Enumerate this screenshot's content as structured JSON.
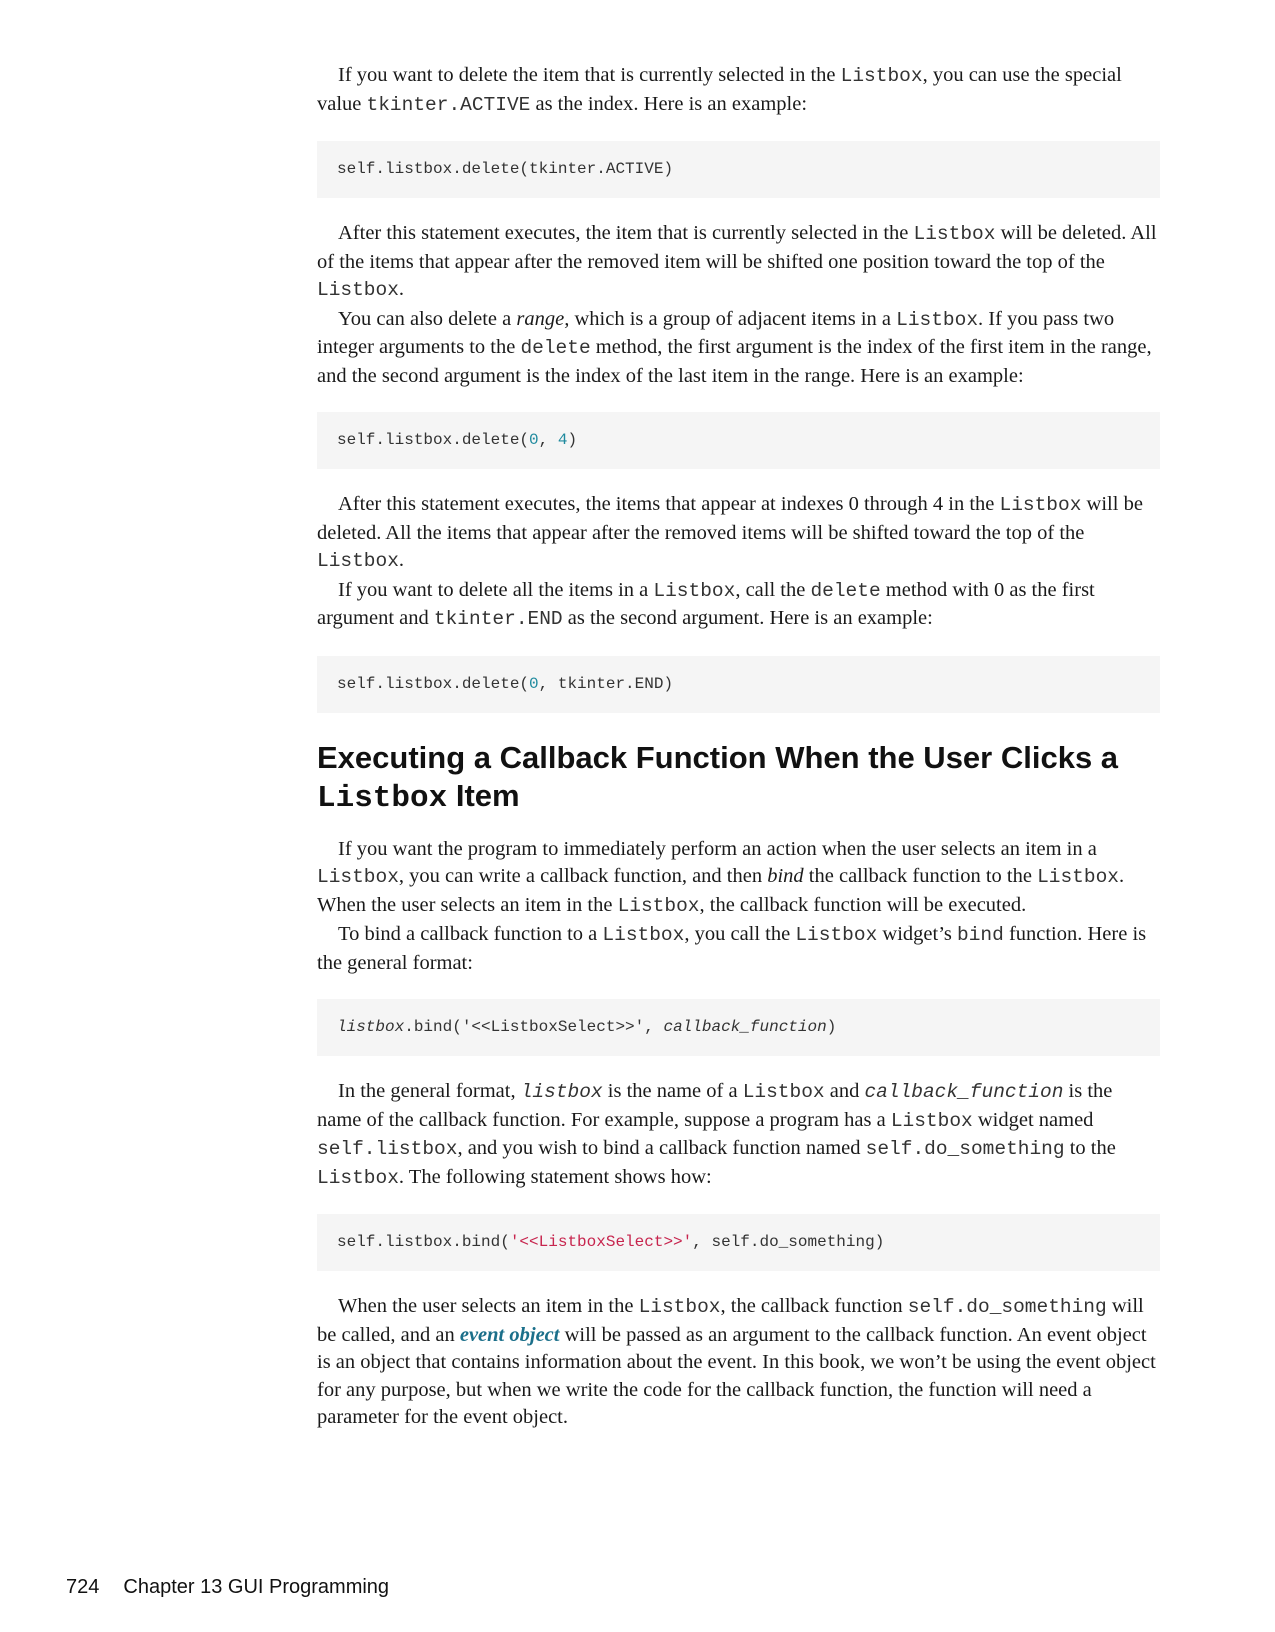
{
  "p1": {
    "a": "If you want to delete the item that is currently selected in the ",
    "b": "Listbox",
    "c": ", you can use the special value ",
    "d": "tkinter.ACTIVE",
    "e": " as the index. Here is an example:"
  },
  "code1": "self.listbox.delete(tkinter.ACTIVE)",
  "p2": {
    "a": "After this statement executes, the item that is currently selected in the ",
    "b": "Listbox",
    "c": " will be deleted. All of the items that appear after the removed item will be shifted one position toward the top of the ",
    "d": "Listbox",
    "e": "."
  },
  "p3": {
    "a": "You can also delete a ",
    "b": "range,",
    "c": " which is a group of adjacent items in a ",
    "d": "Listbox",
    "e": ". If you pass two integer arguments to the ",
    "f": "delete",
    "g": " method, the first argument is the index of the first item in the range, and the second argument is the index of the last item in the range. Here is an example:"
  },
  "code2": {
    "a": "self.listbox.delete(",
    "n1": "0",
    "b": ", ",
    "n2": "4",
    "c": ")"
  },
  "p4": {
    "a": "After this statement executes, the items that appear at indexes 0 through 4 in the ",
    "b": "Listbox",
    "c": " will be deleted. All the items that appear after the removed items will be shifted toward the top of the ",
    "d": "Listbox",
    "e": "."
  },
  "p5": {
    "a": "If you want to delete all the items in a ",
    "b": "Listbox",
    "c": ", call the ",
    "d": "delete",
    "e": " method with 0 as the first argument and ",
    "f": "tkinter.END",
    "g": " as the second argument. Here is an example:"
  },
  "code3": {
    "a": "self.listbox.delete(",
    "n1": "0",
    "b": ", tkinter.END)"
  },
  "heading": {
    "a": "Executing a Callback Function When the User Clicks a ",
    "b": "Listbox",
    "c": " Item"
  },
  "p6": {
    "a": "If you want the program to immediately perform an action when the user selects an item in a ",
    "b": "Listbox",
    "c": ", you can write a callback function, and then ",
    "d": "bind",
    "e": " the callback function to the ",
    "f": "Listbox",
    "g": ". When the user selects an item in the ",
    "h": "Listbox",
    "i": ", the callback function will be executed."
  },
  "p7": {
    "a": "To bind a callback function to a ",
    "b": "Listbox",
    "c": ", you call the ",
    "d": "Listbox",
    "e": " widget’s ",
    "f": "bind",
    "g": " function. Here is the general format:"
  },
  "code4": {
    "a": "listbox",
    "b": ".bind('<<ListboxSelect>>', ",
    "c": "callback_function",
    "d": ")"
  },
  "p8": {
    "a": "In the general format, ",
    "b": "listbox",
    "c": " is the name of a ",
    "d": "Listbox",
    "e": " and ",
    "f": "callback_function",
    "g": " is the name of the callback function. For example, suppose a program has a ",
    "h": "Listbox",
    "i": " widget named ",
    "j": "self.listbox",
    "k": ", and you wish to bind a callback function named ",
    "l": "self.do_something",
    "m": " to the ",
    "n": "Listbox",
    "o": ". The following statement shows how:"
  },
  "code5": {
    "a": "self.listbox.bind(",
    "s": "'<<ListboxSelect>>'",
    "b": ", self.do_something)"
  },
  "p9": {
    "a": "When the user selects an item in the ",
    "b": "Listbox",
    "c": ", the callback function ",
    "d": "self.do_something",
    "e": " will be called, and an ",
    "f": "event object",
    "g": " will be passed as an argument to the callback function. An event object is an object that contains information about the event. In this book, we won’t be using the event object for any purpose, but when we write the code for the callback function, the function will need a parameter for the event object."
  },
  "footer": {
    "page": "724",
    "chapter": "Chapter 13 GUI Programming"
  }
}
